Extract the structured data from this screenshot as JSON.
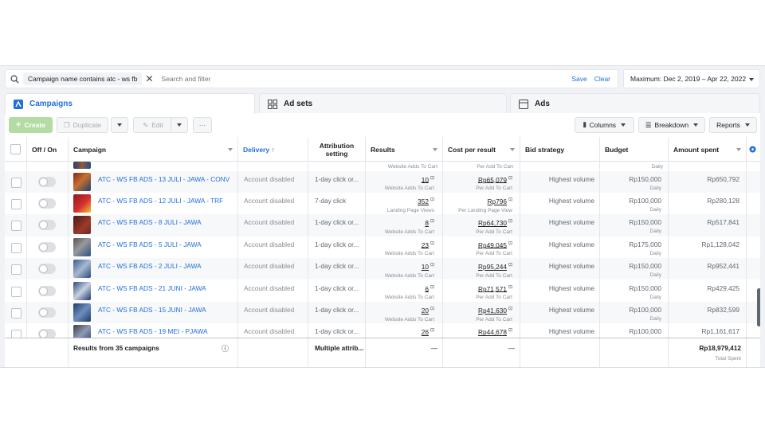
{
  "search": {
    "filter_chip": "Campaign name contains atc - ws fb",
    "placeholder": "Search and filter",
    "save": "Save",
    "clear": "Clear"
  },
  "date_range": "Maximum: Dec 2, 2019 – Apr 22, 2022",
  "tabs": [
    {
      "label": "Campaigns",
      "icon": "campaigns-icon",
      "active": true
    },
    {
      "label": "Ad sets",
      "icon": "adsets-icon",
      "active": false
    },
    {
      "label": "Ads",
      "icon": "ads-icon",
      "active": false
    }
  ],
  "toolbar": {
    "create": "Create",
    "duplicate": "Duplicate",
    "edit": "Edit",
    "more": "···",
    "columns": "Columns",
    "breakdown": "Breakdown",
    "reports": "Reports"
  },
  "columns": {
    "offon": "Off / On",
    "campaign": "Campaign",
    "delivery": "Delivery ↑",
    "attribution": "Attribution setting",
    "results": "Results",
    "cpr": "Cost per result",
    "bid": "Bid strategy",
    "budget": "Budget",
    "amount": "Amount spent"
  },
  "partial_top_row": {
    "results_sub": "Website Adds To Cart",
    "cpr_sub": "Per Add To Cart",
    "budget_sub": "Daily"
  },
  "rows": [
    {
      "name": "ATC - WS FB ADS - 13 JULI - JAWA - CONV",
      "delivery": "Account disabled",
      "attribution": "1-day click or...",
      "results": "10",
      "results_sub": "Website Adds To Cart",
      "cpr": "Rp65,079",
      "cpr_sub": "Per Add To Cart",
      "bid": "Highest volume",
      "budget": "Rp150,000",
      "budget_sub": "Daily",
      "amount": "Rp650,792"
    },
    {
      "name": "ATC - WS FB ADS - 12 JULI - JAWA - TRF",
      "delivery": "Account disabled",
      "attribution": "7-day click",
      "results": "352",
      "results_sub": "Landing Page Views",
      "cpr": "Rp796",
      "cpr_sub": "Per Landing Page View",
      "bid": "Highest volume",
      "budget": "Rp100,000",
      "budget_sub": "Daily",
      "amount": "Rp280,128"
    },
    {
      "name": "ATC - WS FB ADS - 8 JULI - JAWA",
      "delivery": "Account disabled",
      "attribution": "1-day click or...",
      "results": "8",
      "results_sub": "Website Adds To Cart",
      "cpr": "Rp64,730",
      "cpr_sub": "Per Add To Cart",
      "bid": "Highest volume",
      "budget": "Rp150,000",
      "budget_sub": "Daily",
      "amount": "Rp517,841"
    },
    {
      "name": "ATC - WS FB ADS - 5 JULI - JAWA",
      "delivery": "Account disabled",
      "attribution": "1-day click or...",
      "results": "23",
      "results_sub": "Website Adds To Cart",
      "cpr": "Rp49,045",
      "cpr_sub": "Per Add To Cart",
      "bid": "Highest volume",
      "budget": "Rp175,000",
      "budget_sub": "Daily",
      "amount": "Rp1,128,042"
    },
    {
      "name": "ATC - WS FB ADS - 2 JULI - JAWA",
      "delivery": "Account disabled",
      "attribution": "1-day click or...",
      "results": "10",
      "results_sub": "Website Adds To Cart",
      "cpr": "Rp95,244",
      "cpr_sub": "Per Add To Cart",
      "bid": "Highest volume",
      "budget": "Rp150,000",
      "budget_sub": "Daily",
      "amount": "Rp952,441"
    },
    {
      "name": "ATC - WS FB ADS - 21 JUNI - JAWA",
      "delivery": "Account disabled",
      "attribution": "1-day click or...",
      "results": "6",
      "results_sub": "Website Adds To Cart",
      "cpr": "Rp71,571",
      "cpr_sub": "Per Add To Cart",
      "bid": "Highest volume",
      "budget": "Rp150,000",
      "budget_sub": "Daily",
      "amount": "Rp429,425"
    },
    {
      "name": "ATC - WS FB ADS - 15 JUNI - JAWA",
      "delivery": "Account disabled",
      "attribution": "1-day click or...",
      "results": "20",
      "results_sub": "Website Adds To Cart",
      "cpr": "Rp41,630",
      "cpr_sub": "Per Add To Cart",
      "bid": "Highest volume",
      "budget": "Rp100,000",
      "budget_sub": "Daily",
      "amount": "Rp832,599"
    },
    {
      "name": "ATC - WS FB ADS - 19 MEI - PJAWA",
      "delivery": "Account disabled",
      "attribution": "1-day click or...",
      "results": "26",
      "results_sub": "Website Adds To Cart",
      "cpr": "Rp44,678",
      "cpr_sub": "Per Add To Cart",
      "bid": "Highest volume",
      "budget": "Rp100,000",
      "budget_sub": "Daily",
      "amount": "Rp1,161,617"
    }
  ],
  "footer": {
    "results_from": "Results from 35 campaigns",
    "attribution": "Multiple attrib...",
    "results": "—",
    "cpr": "—",
    "amount": "Rp18,979,412",
    "amount_sub": "Total Spent"
  },
  "colors": {
    "accent": "#216fdb",
    "create_button": "#b5dba5",
    "page_bg": "#f0f2f5"
  }
}
